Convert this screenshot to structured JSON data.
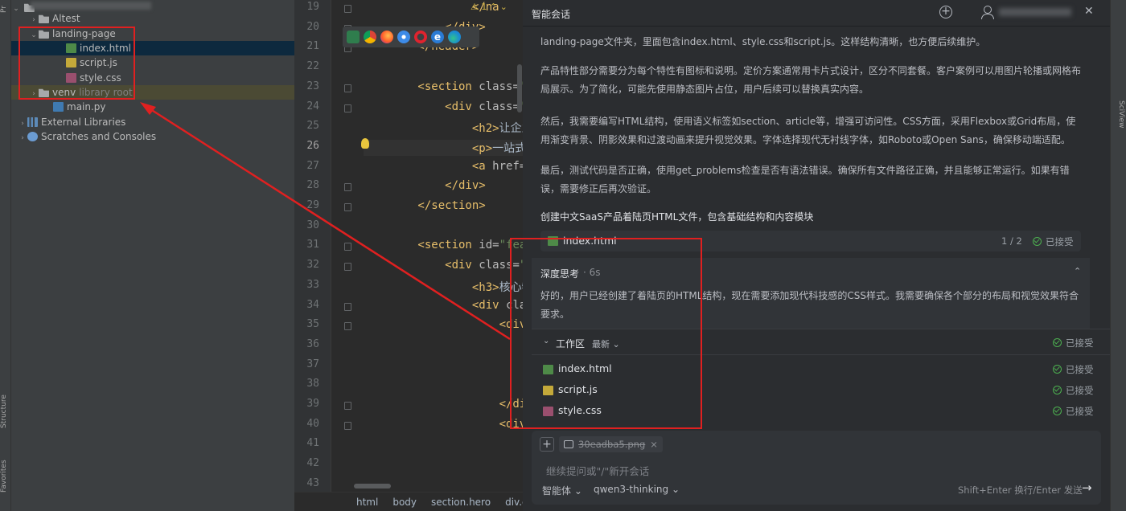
{
  "side_tabs": {
    "project": "Pr",
    "structure": "Structure",
    "favorites": "Favorites",
    "sciview": "SciView"
  },
  "project_tree": [
    {
      "label": "Altest",
      "muted": "",
      "icon": "folder-icon",
      "kind": "folder",
      "arrow": "›"
    },
    {
      "label": "landing-page",
      "muted": "",
      "icon": "folder-icon",
      "kind": "folder",
      "arrow": "⌄"
    },
    {
      "label": "index.html",
      "muted": "",
      "icon": "html-file-icon",
      "kind": "html",
      "arrow": ""
    },
    {
      "label": "script.js",
      "muted": "",
      "icon": "js-file-icon",
      "kind": "js",
      "arrow": ""
    },
    {
      "label": "style.css",
      "muted": "",
      "icon": "css-file-icon",
      "kind": "css",
      "arrow": ""
    },
    {
      "label": "venv",
      "muted": "library root",
      "icon": "folder-icon",
      "kind": "folder",
      "arrow": "›"
    },
    {
      "label": "main.py",
      "muted": "",
      "icon": "python-file-icon",
      "kind": "py",
      "arrow": ""
    },
    {
      "label": "External Libraries",
      "muted": "",
      "icon": "library-icon",
      "kind": "lib",
      "arrow": "›"
    },
    {
      "label": "Scratches and Consoles",
      "muted": "",
      "icon": "scratch-icon",
      "kind": "scratch",
      "arrow": "›"
    }
  ],
  "editor": {
    "line_numbers": [
      "19",
      "20",
      "21",
      "22",
      "23",
      "24",
      "25",
      "26",
      "27",
      "28",
      "29",
      "30",
      "31",
      "32",
      "33",
      "34",
      "35",
      "36",
      "37",
      "38",
      "39",
      "40",
      "41",
      "42",
      "43"
    ],
    "current_line": "26",
    "warning_count": "1",
    "lines": [
      [
        {
          "c": "tag",
          "t": "                </na"
        }
      ],
      [
        {
          "c": "tag",
          "t": "            </div>"
        }
      ],
      [
        {
          "c": "tag",
          "t": "        </header>"
        }
      ],
      [],
      [
        {
          "c": "tag",
          "t": "        <section "
        },
        {
          "c": "attr",
          "t": "class="
        },
        {
          "c": "str",
          "t": "\"hero"
        }
      ],
      [
        {
          "c": "tag",
          "t": "            <div "
        },
        {
          "c": "attr",
          "t": "class="
        },
        {
          "c": "str",
          "t": "\"cont"
        }
      ],
      [
        {
          "c": "tag",
          "t": "                <h2>"
        },
        {
          "c": "txt",
          "t": "让企业数字"
        }
      ],
      [
        {
          "c": "tag",
          "t": "                <p>"
        },
        {
          "c": "txt",
          "t": "一站式云端应"
        }
      ],
      [
        {
          "c": "tag",
          "t": "                <a "
        },
        {
          "c": "attr",
          "t": "href="
        },
        {
          "c": "str",
          "t": "\"#pr"
        }
      ],
      [
        {
          "c": "tag",
          "t": "            </div>"
        }
      ],
      [
        {
          "c": "tag",
          "t": "        </section>"
        }
      ],
      [],
      [
        {
          "c": "tag",
          "t": "        <section "
        },
        {
          "c": "attr",
          "t": "id="
        },
        {
          "c": "str",
          "t": "\"feature"
        }
      ],
      [
        {
          "c": "tag",
          "t": "            <div "
        },
        {
          "c": "attr",
          "t": "class="
        },
        {
          "c": "str",
          "t": "\"cont"
        }
      ],
      [
        {
          "c": "tag",
          "t": "                <h3>"
        },
        {
          "c": "txt",
          "t": "核心特性<"
        }
      ],
      [
        {
          "c": "tag",
          "t": "                <div "
        },
        {
          "c": "attr",
          "t": "class="
        },
        {
          "c": "str",
          "t": "\""
        }
      ],
      [
        {
          "c": "tag",
          "t": "                    <div "
        },
        {
          "c": "attr",
          "t": "cla"
        }
      ],
      [
        {
          "c": "tag",
          "t": "                        <div"
        }
      ],
      [
        {
          "c": "tag",
          "t": "                        <h4>"
        }
      ],
      [
        {
          "c": "tag",
          "t": "                        <p>"
        },
        {
          "c": "txt",
          "t": "实"
        }
      ],
      [
        {
          "c": "tag",
          "t": "                    </div>"
        }
      ],
      [
        {
          "c": "tag",
          "t": "                    <div "
        },
        {
          "c": "attr",
          "t": "cla"
        }
      ],
      [
        {
          "c": "tag",
          "t": "                        <div"
        }
      ],
      [
        {
          "c": "tag",
          "t": "                        <h4>"
        }
      ],
      [
        {
          "c": "tag",
          "t": "                        <p>"
        },
        {
          "c": "txt",
          "t": "锁"
        }
      ]
    ],
    "breadcrumb": [
      "html",
      "body",
      "section.hero",
      "div.c"
    ]
  },
  "chat": {
    "title": "智能会话",
    "paragraphs": [
      "landing-page文件夹，里面包含index.html、style.css和script.js。这样结构清晰，也方便后续维护。",
      "产品特性部分需要分为每个特性有图标和说明。定价方案通常用卡片式设计，区分不同套餐。客户案例可以用图片轮播或网格布局展示。为了简化，可能先使用静态图片占位，用户后续可以替换真实内容。",
      "然后，我需要编写HTML结构，使用语义标签如section、article等，增强可访问性。CSS方面，采用Flexbox或Grid布局，使用渐变背景、阴影效果和过渡动画来提升视觉效果。字体选择现代无衬线字体，如Roboto或Open Sans，确保移动端适配。",
      "最后，测试代码是否正确，使用get_problems检查是否有语法错误。确保所有文件路径正确，并且能够正常运行。如果有错误，需要修正后再次验证。"
    ],
    "task": {
      "title": "创建中文SaaS产品着陆页HTML文件，包含基础结构和内容模块",
      "file": "index.html",
      "pager": "1 / 2",
      "status": "已接受"
    },
    "thinking": {
      "label": "深度思考",
      "time": "· 6s",
      "collapse": "⌃",
      "text": "好的，用户已经创建了着陆页的HTML结构，现在需要添加现代科技感的CSS样式。我需要确保各个部分的布局和视觉效果符合要求。"
    },
    "workspace": {
      "toggle": "⌄",
      "title": "工作区",
      "filter": "最新 ⌄",
      "status": "已接受",
      "files": [
        {
          "name": "index.html",
          "icon": "html-file-icon",
          "kind": "html",
          "status": "已接受"
        },
        {
          "name": "script.js",
          "icon": "js-file-icon",
          "kind": "js",
          "status": "已接受"
        },
        {
          "name": "style.css",
          "icon": "css-file-icon",
          "kind": "css",
          "status": "已接受"
        }
      ]
    },
    "input": {
      "attachment": "30eadba5.png",
      "remove": "×",
      "placeholder": "继续提问或\"/\"新开会话",
      "agent": "智能体 ⌄",
      "model": "qwen3-thinking ⌄",
      "send_hint": "Shift+Enter 换行/Enter 发送",
      "send_icon": "→"
    }
  },
  "colors": {
    "annotation": "#e02020",
    "accepted": "#4caf50"
  }
}
